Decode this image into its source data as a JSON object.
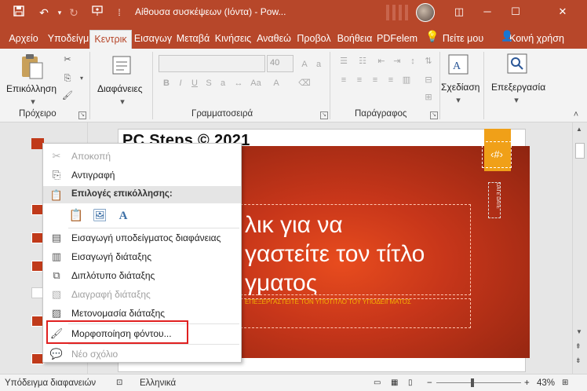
{
  "titlebar": {
    "title": "Αίθουσα συσκέψεων (Ιόντα)  -  Pow...",
    "icons": [
      "save-icon",
      "undo-icon",
      "redo-icon",
      "present-icon",
      "customize-icon"
    ],
    "window_buttons": [
      "─",
      "☐",
      "✕",
      "◫"
    ]
  },
  "tabs": [
    {
      "label": "Αρχείο"
    },
    {
      "label": "Υποδείγμ"
    },
    {
      "label": "Κεντρικ"
    },
    {
      "label": "Εισαγωγ"
    },
    {
      "label": "Μεταβά"
    },
    {
      "label": "Κινήσεις"
    },
    {
      "label": "Αναθεώ"
    },
    {
      "label": "Προβολ"
    },
    {
      "label": "Βοήθεια"
    },
    {
      "label": "PDFelem"
    },
    {
      "label": "Πείτε μου"
    },
    {
      "label": "Κοινή χρήση"
    }
  ],
  "ribbon": {
    "paste_label": "Επικόλληση",
    "clipboard_group": "Πρόχειρο",
    "slides_label": "Διαφάνειες",
    "font_group": "Γραμματοσειρά",
    "font_size": "40",
    "paragraph_group": "Παράγραφος",
    "design_label": "Σχεδίαση",
    "edit_label": "Επεξεργασία"
  },
  "slide": {
    "header": "PC Steps © 2021",
    "number": "‹#›",
    "title": "λικ για να\nγαστείτε τον τίτλο\nγματος",
    "subtitle": "ΕΠΕΞΕΡΓΑΣΤΕΙΤΕ ΤΟΝ ΥΠΟΤΙΤΛΟ ΤΟΥ ΥΠΟΔΕΙΓΜΑΤΟΣ"
  },
  "context_menu": {
    "cut": "Αποκοπή",
    "copy": "Αντιγραφή",
    "paste_options": "Επιλογές επικόλλησης:",
    "insert_master": "Εισαγωγή υποδείγματος διαφάνειας",
    "insert_layout": "Εισαγωγή διάταξης",
    "duplicate_layout": "Διπλότυπο διάταξης",
    "delete_layout": "Διαγραφή διάταξης",
    "rename_layout": "Μετονομασία διάταξης",
    "format_background": "Μορφοποίηση φόντου...",
    "new_comment": "Νέο σχόλιο"
  },
  "statusbar": {
    "view": "Υπόδειγμα διαφανειών",
    "language": "Ελληνικά",
    "zoom": "43%"
  },
  "colors": {
    "accent": "#b7472a",
    "highlight_box": "#e02020",
    "slide_orange": "#f0a018"
  }
}
